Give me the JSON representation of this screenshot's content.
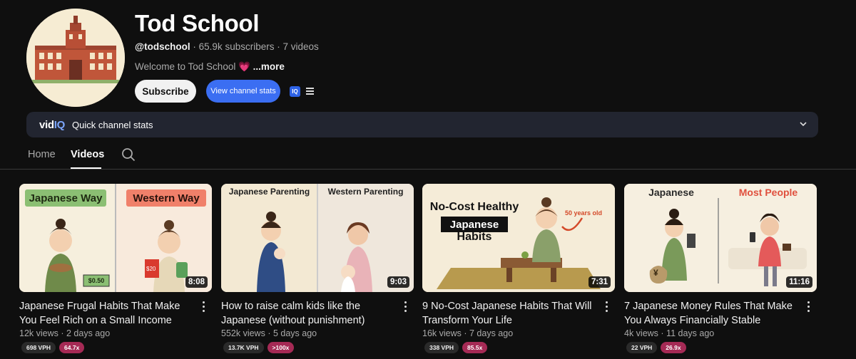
{
  "channel": {
    "name": "Tod School",
    "handle": "@todschool",
    "meta_suffix": " · 65.9k subscribers · 7 videos",
    "description": "Welcome to Tod School",
    "description_emoji": "💗",
    "more_label": "...more"
  },
  "actions": {
    "subscribe_label": "Subscribe",
    "view_stats_label": "View channel stats",
    "iq_badge": "IQ"
  },
  "vidiq_bar": {
    "logo_main": "vid",
    "logo_iq": "IQ",
    "label": "Quick channel stats"
  },
  "tabs": [
    {
      "label": "Home"
    },
    {
      "label": "Videos"
    }
  ],
  "videos": [
    {
      "title": "Japanese Frugal Habits That Make You Feel Rich on a Small Income",
      "views": "12k views",
      "age": "2 days ago",
      "duration": "8:08",
      "vph": "698 VPH",
      "multiplier": "64.7x",
      "thumb_left_label": "Japanese Way",
      "thumb_right_label": "Western Way",
      "thumb_price_left": "$0.50",
      "thumb_price_right": "$20"
    },
    {
      "title": "How to raise calm kids like the Japanese (without punishment)",
      "views": "552k views",
      "age": "5 days ago",
      "duration": "9:03",
      "vph": "13.7K VPH",
      "multiplier": ">100x",
      "thumb_left_label": "Japanese Parenting",
      "thumb_right_label": "Western Parenting"
    },
    {
      "title": "9 No-Cost Japanese Habits That Will Transform Your Life",
      "views": "16k views",
      "age": "7 days ago",
      "duration": "7:31",
      "vph": "338 VPH",
      "multiplier": "85.5x",
      "thumb_line1": "No-Cost Healthy",
      "thumb_line2": "Japanese",
      "thumb_line3": "Habits",
      "thumb_age_label": "50 years old"
    },
    {
      "title": "7 Japanese Money Rules That Make You Always Financially Stable",
      "views": "4k views",
      "age": "11 days ago",
      "duration": "11:16",
      "vph": "22 VPH",
      "multiplier": "26.9x",
      "thumb_left_label": "Japanese",
      "thumb_right_label": "Most People",
      "thumb_yen": "¥"
    }
  ]
}
